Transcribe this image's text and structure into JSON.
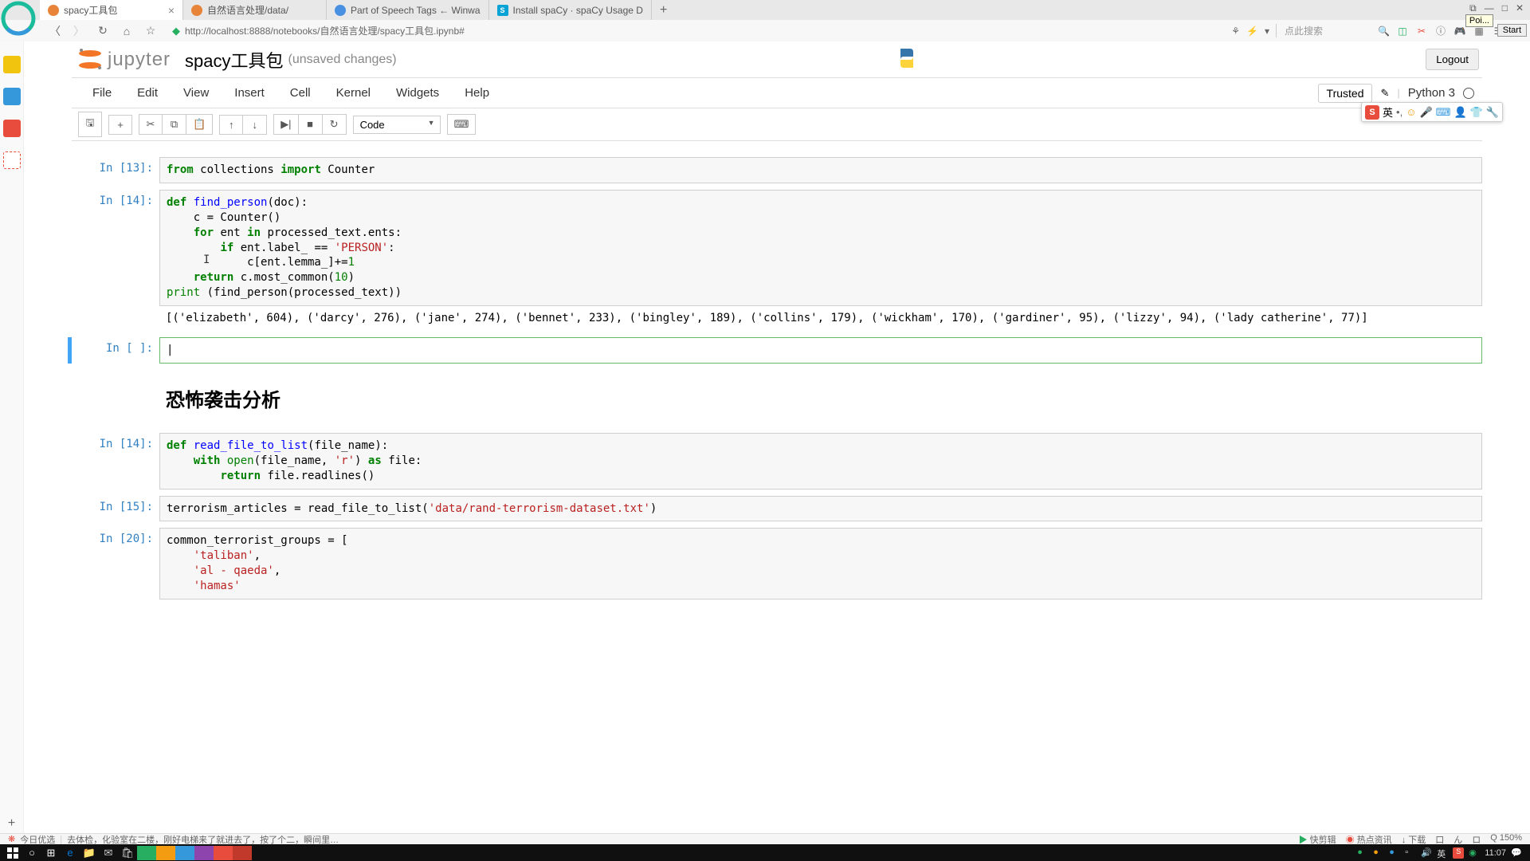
{
  "tabs": [
    {
      "title": "spacy工具包",
      "active": true,
      "favicon": "#E8833A"
    },
    {
      "title": "自然语言处理/data/",
      "active": false,
      "favicon": "#E8833A"
    },
    {
      "title": "Part of Speech Tags ← Winwa",
      "active": false,
      "favicon": "#4A90E2"
    },
    {
      "title": "Install spaCy · spaCy Usage D",
      "active": false,
      "favicon": "#09A3D5"
    }
  ],
  "address": "http://localhost:8888/notebooks/自然语言处理/spacy工具包.ipynb#",
  "search_placeholder": "点此搜索",
  "tooltip": "Poi...",
  "start_button": "Start",
  "jupyter": {
    "title": "spacy工具包",
    "unsaved": "(unsaved changes)",
    "logout": "Logout",
    "trusted": "Trusted",
    "kernel": "Python 3",
    "celltype": "Code",
    "menu": [
      "File",
      "Edit",
      "View",
      "Insert",
      "Cell",
      "Kernel",
      "Widgets",
      "Help"
    ]
  },
  "cells": {
    "c1_prompt": "In [13]:",
    "c2_prompt": "In [14]:",
    "c2_output": "[('elizabeth', 604), ('darcy', 276), ('jane', 274), ('bennet', 233), ('bingley', 189), ('collins', 179), ('wickham', 170), ('gardiner', 95), ('lizzy', 94), ('lady catherine', 77)]",
    "c3_prompt": "In [ ]:",
    "md_heading": "恐怖袭击分析",
    "c4_prompt": "In [14]:",
    "c5_prompt": "In [15]:",
    "c6_prompt": "In [20]:"
  },
  "info_bar": {
    "left_icon": "今日优选",
    "left_text": "去体检，化验室在二楼，刚好电梯来了就进去了，按了个二，瞬间里…",
    "r1": "快剪辑",
    "r2": "热点资讯",
    "r3": "↓ 下载",
    "r4": "口",
    "r5": "ん",
    "r6": "ロ",
    "r7": "Q 150%"
  },
  "ime": {
    "lang": "英"
  },
  "clock": "11:07"
}
